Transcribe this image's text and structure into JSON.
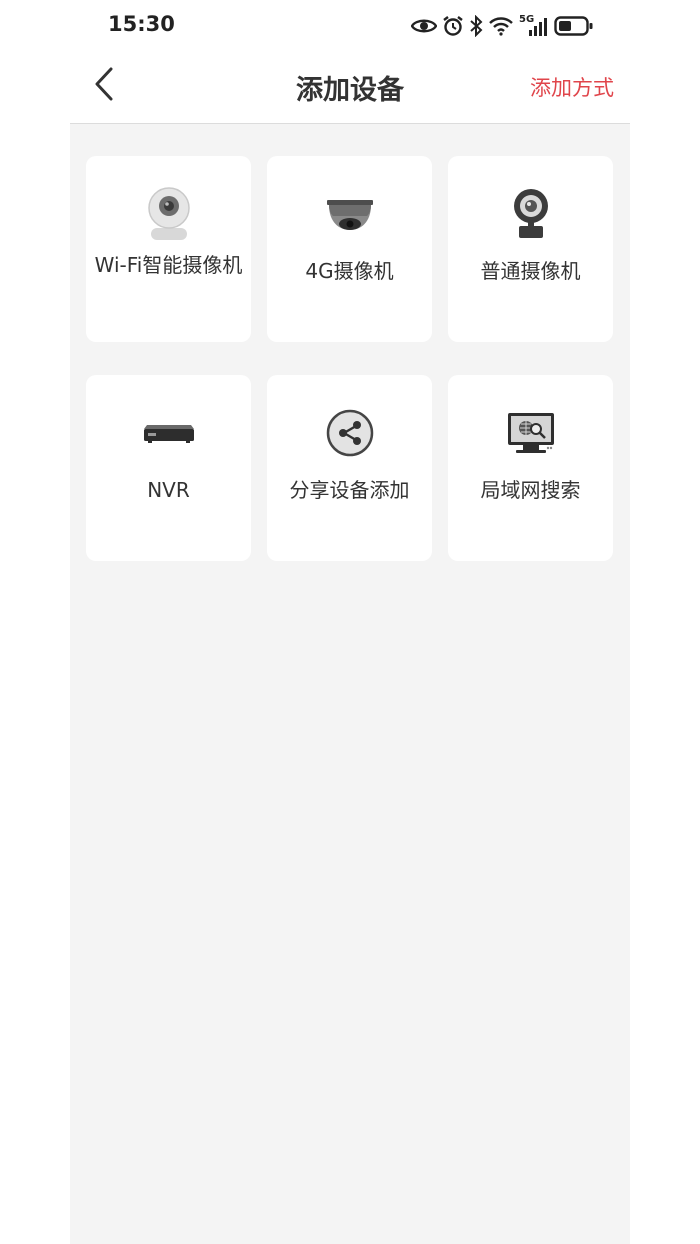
{
  "status_bar": {
    "time": "15:30",
    "icons": [
      "eye-icon",
      "alarm-icon",
      "bluetooth-icon",
      "wifi-icon",
      "signal-5g-icon",
      "battery-icon"
    ],
    "network_label": "5G"
  },
  "nav": {
    "title": "添加设备",
    "action_label": "添加方式",
    "back_icon": "chevron-left-icon"
  },
  "colors": {
    "accent": "#e0454b",
    "background": "#f4f4f4",
    "card": "#ffffff",
    "text": "#333333"
  },
  "devices": [
    {
      "label": "Wi-Fi智能摄像机",
      "icon": "wifi-camera-icon"
    },
    {
      "label": "4G摄像机",
      "icon": "dome-camera-icon"
    },
    {
      "label": "普通摄像机",
      "icon": "webcam-icon"
    },
    {
      "label": "NVR",
      "icon": "nvr-icon"
    },
    {
      "label": "分享设备添加",
      "icon": "share-icon"
    },
    {
      "label": "局域网搜索",
      "icon": "lan-search-icon"
    }
  ]
}
